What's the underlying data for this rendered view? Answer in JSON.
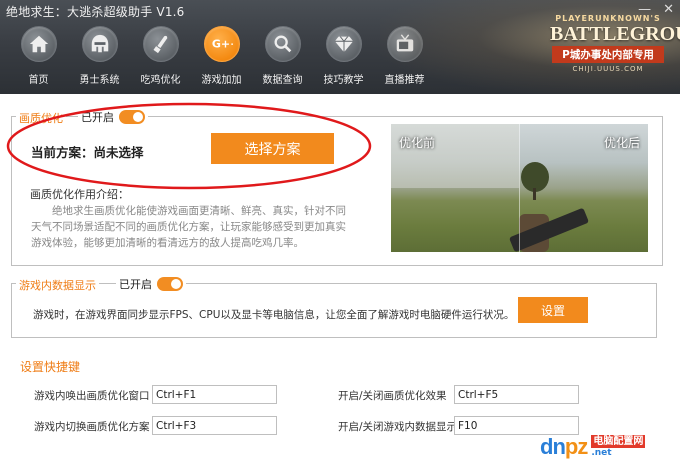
{
  "window": {
    "title": "绝地求生：大逃杀超级助手 V1.6",
    "controls": [
      "—",
      "✕"
    ]
  },
  "nav": {
    "items": [
      {
        "label": "首页",
        "icon": "home-icon"
      },
      {
        "label": "勇士系统",
        "icon": "helmet-icon"
      },
      {
        "label": "吃鸡优化",
        "icon": "bullet-icon"
      },
      {
        "label": "游戏加加",
        "icon": "g-plus-icon",
        "active": true
      },
      {
        "label": "数据查询",
        "icon": "search-icon"
      },
      {
        "label": "技巧教学",
        "icon": "diamond-icon"
      },
      {
        "label": "直播推荐",
        "icon": "tv-icon"
      }
    ]
  },
  "brand": {
    "top": "PLAYERUNKNOWN'S",
    "main": "BATTLEGROUNDS",
    "sub": "P城办事处内部专用",
    "url": "CHIJI.UUUS.COM"
  },
  "graphics": {
    "title": "画质优化",
    "toggle_label": "已开启",
    "current_plan": "当前方案：尚未选择",
    "select_button": "选择方案",
    "intro_title": "画质优化作用介绍：",
    "intro_text": "绝地求生画质优化能使游戏画面更清晰、鲜亮、真实，针对不同天气不同场景适配不同的画质优化方案，让玩家能够感受到更加真实游戏体验，能够更加清晰的看清远方的敌人提高吃鸡几率。",
    "before_label": "优化前",
    "after_label": "优化后"
  },
  "ingame": {
    "title": "游戏内数据显示",
    "toggle_label": "已开启",
    "description": "游戏时，在游戏界面同步显示FPS、CPU以及显卡等电脑信息，让您全面了解游戏时电脑硬件运行状况。",
    "settings_button": "设置"
  },
  "hotkeys": {
    "title": "设置快捷键",
    "items": [
      {
        "label": "游戏内唤出画质优化窗口",
        "value": "Ctrl+F1"
      },
      {
        "label": "开启/关闭画质优化效果",
        "value": "Ctrl+F5"
      },
      {
        "label": "游戏内切换画质优化方案",
        "value": "Ctrl+F3"
      },
      {
        "label": "开启/关闭游戏内数据显示",
        "value": "F10"
      }
    ]
  },
  "watermark": {
    "logo_a": "dn",
    "logo_b": "pz",
    "logo_c": ".net",
    "cn": "电脑配置网"
  },
  "colors": {
    "accent": "#f28a1d",
    "header": "#3a3e44",
    "annotation": "#e0191b"
  }
}
